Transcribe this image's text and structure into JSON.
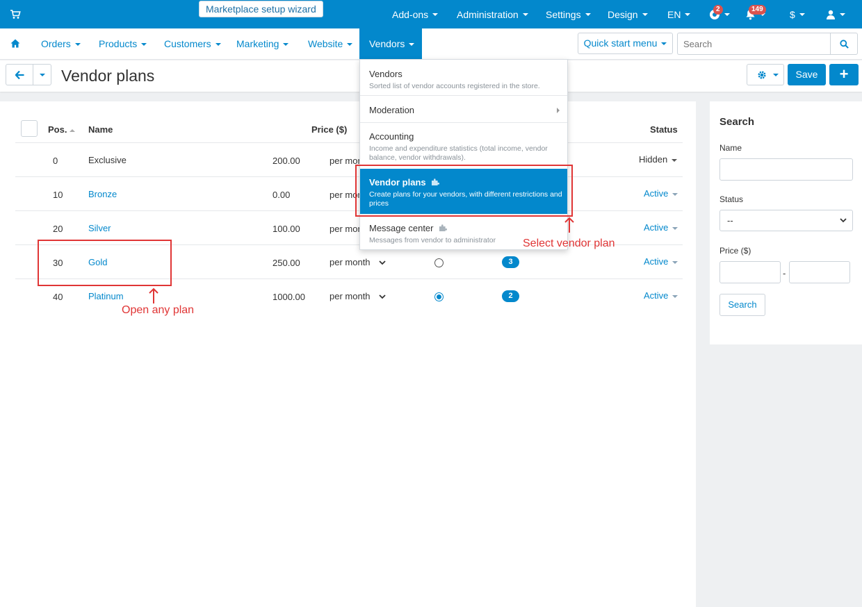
{
  "topbar": {
    "wizard_label": "Marketplace setup wizard",
    "items": [
      {
        "label": "Add-ons"
      },
      {
        "label": "Administration"
      },
      {
        "label": "Settings"
      },
      {
        "label": "Design"
      },
      {
        "label": "EN"
      }
    ],
    "help_badge": "2",
    "notifications_badge": "149",
    "currency_label": "$"
  },
  "nav": {
    "items": [
      {
        "label": "Orders"
      },
      {
        "label": "Products"
      },
      {
        "label": "Customers"
      },
      {
        "label": "Marketing"
      },
      {
        "label": "Website"
      },
      {
        "label": "Vendors"
      }
    ],
    "quick_start_label": "Quick start menu",
    "search_placeholder": "Search"
  },
  "header": {
    "title": "Vendor plans",
    "save_label": "Save"
  },
  "table": {
    "headers": {
      "pos": "Pos.",
      "name": "Name",
      "price": "Price ($)",
      "status": "Status"
    },
    "rows": [
      {
        "pos": "0",
        "name": "Exclusive",
        "price": "200.00",
        "period": "per mon",
        "status": "Hidden"
      },
      {
        "pos": "10",
        "name": "Bronze",
        "price": "0.00",
        "period": "per mon",
        "status": "Active"
      },
      {
        "pos": "20",
        "name": "Silver",
        "price": "100.00",
        "period": "per mon",
        "status": "Active"
      },
      {
        "pos": "30",
        "name": "Gold",
        "price": "250.00",
        "period": "per month",
        "count": "3",
        "status": "Active"
      },
      {
        "pos": "40",
        "name": "Platinum",
        "price": "1000.00",
        "period": "per month",
        "count": "2",
        "status": "Active"
      }
    ]
  },
  "dropdown": {
    "items": [
      {
        "title": "Vendors",
        "desc": "Sorted list of vendor accounts registered in the store."
      },
      {
        "title": "Moderation",
        "desc": ""
      },
      {
        "title": "Accounting",
        "desc": "Income and expenditure statistics (total income, vendor balance, vendor withdrawals)."
      },
      {
        "title": "Vendor plans",
        "desc": "Create plans for your vendors, with different restrictions and prices"
      },
      {
        "title": "Message center",
        "desc": "Messages from vendor to administrator"
      }
    ]
  },
  "sidebar": {
    "title": "Search",
    "name_label": "Name",
    "status_label": "Status",
    "status_value": "--",
    "price_label": "Price ($)",
    "price_sep": "-",
    "search_label": "Search"
  },
  "annotations": {
    "select_plan": "Select vendor plan",
    "open_plan": "Open any plan"
  },
  "colors": {
    "accent": "#0388cc",
    "annotation": "#e03535",
    "badge": "#d9534f"
  }
}
